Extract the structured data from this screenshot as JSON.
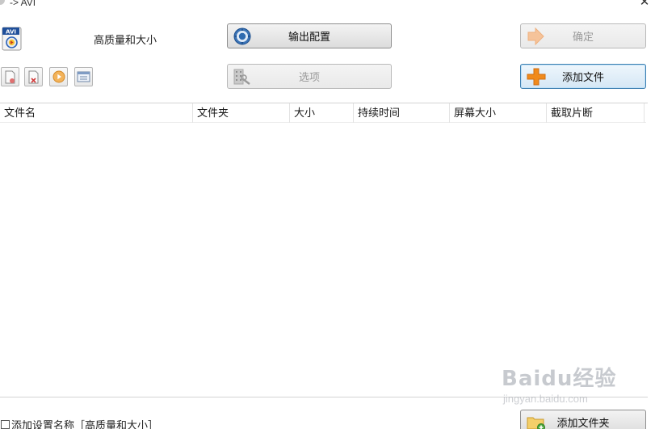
{
  "window": {
    "title": "-> AVI",
    "close_symbol": "✕"
  },
  "profile": {
    "logo_text": "AVI",
    "name": "高质量和大小"
  },
  "buttons": {
    "output_config": "输出配置",
    "ok": "确定",
    "options": "选项",
    "add_file": "添加文件",
    "add_folder": "添加文件夹"
  },
  "toolbar": {
    "icons": [
      "new-file-icon",
      "delete-file-icon",
      "play-icon",
      "view-list-icon"
    ]
  },
  "table": {
    "columns": [
      "文件名",
      "文件夹",
      "大小",
      "持续时间",
      "屏幕大小",
      "截取片断"
    ],
    "rows": []
  },
  "footer": {
    "save_name_label": "添加设置名称［高质量和大小］",
    "save_name_checked": false
  },
  "watermark": {
    "logo": "Baidu经验",
    "url": "jingyan.baidu.com"
  },
  "colors": {
    "primary_border": "#3c7fb1",
    "add_plus": "#f08a1c",
    "ok_arrow": "#f3b07a"
  }
}
